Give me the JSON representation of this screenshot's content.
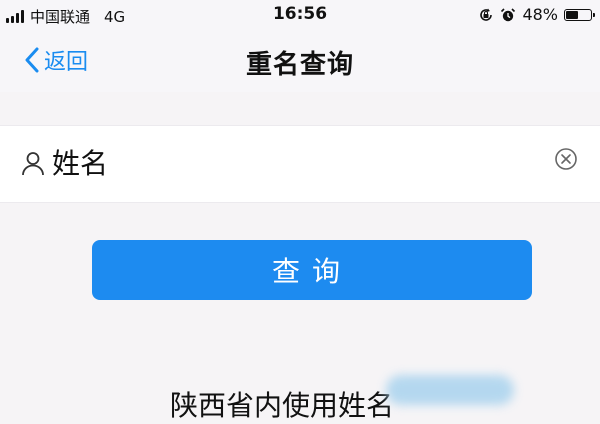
{
  "status_bar": {
    "carrier": "中国联通",
    "network": "4G",
    "time": "16:56",
    "battery": "48%",
    "battery_level": 0.48,
    "icons": [
      "signal-icon",
      "rotation-lock-icon",
      "alarm-icon",
      "battery-icon"
    ]
  },
  "navbar": {
    "back_label": "返回",
    "title": "重名查询"
  },
  "search": {
    "placeholder": "姓名",
    "value": ""
  },
  "query_button": {
    "label": "查询"
  },
  "footer": {
    "text": "陕西省内使用姓名"
  },
  "colors": {
    "accent": "#1d8bf0",
    "link": "#1a8cf0",
    "background": "#f6f4f6"
  }
}
